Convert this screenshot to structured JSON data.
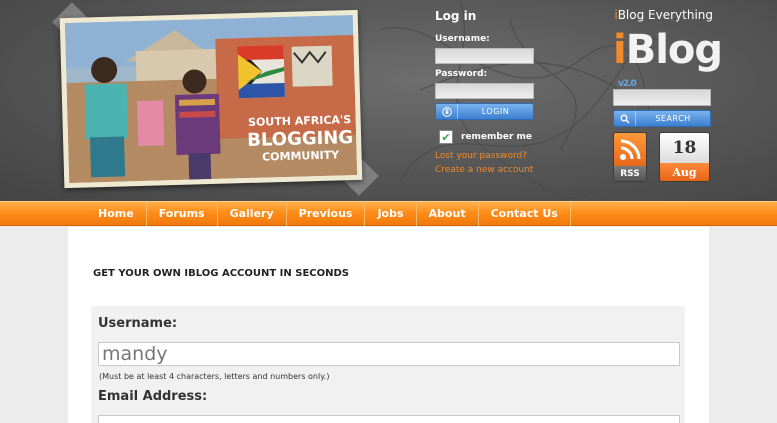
{
  "photo": {
    "line1": "SOUTH AFRICA'S",
    "line2": "BLOGGING",
    "line3": "COMMUNITY"
  },
  "login": {
    "title": "Log in",
    "username_label": "Username:",
    "password_label": "Password:",
    "username_value": "",
    "password_value": "",
    "login_button": "LOGIN",
    "remember_label": "remember me",
    "lost_password": "Lost your password?",
    "create_account": "Create a new account"
  },
  "brand": {
    "tagline_prefix": "i",
    "tagline_rest": "Blog Everything",
    "logo_i": "i",
    "logo_rest": "Blog",
    "version": "v2.0",
    "search_value": "",
    "search_button": "SEARCH",
    "rss_label": "RSS",
    "date_day": "18",
    "date_month": "Aug"
  },
  "nav": {
    "items": [
      "Home",
      "Forums",
      "Gallery",
      "Previous",
      "Jobs",
      "About",
      "Contact Us"
    ]
  },
  "content": {
    "heading": "GET YOUR OWN IBLOG ACCOUNT IN SECONDS",
    "username_label": "Username:",
    "username_value": "mandy",
    "username_hint": "(Must be at least 4 characters, letters and numbers only.)",
    "email_label": "Email Address:",
    "email_value": ""
  },
  "colors": {
    "accent_orange": "#f08a2a",
    "nav_orange": "#ff8d1a",
    "button_blue": "#3d7fd0",
    "header_gray": "#555555"
  },
  "icons": [
    "lock-icon",
    "search-icon",
    "checkmark-icon",
    "rss-icon"
  ]
}
